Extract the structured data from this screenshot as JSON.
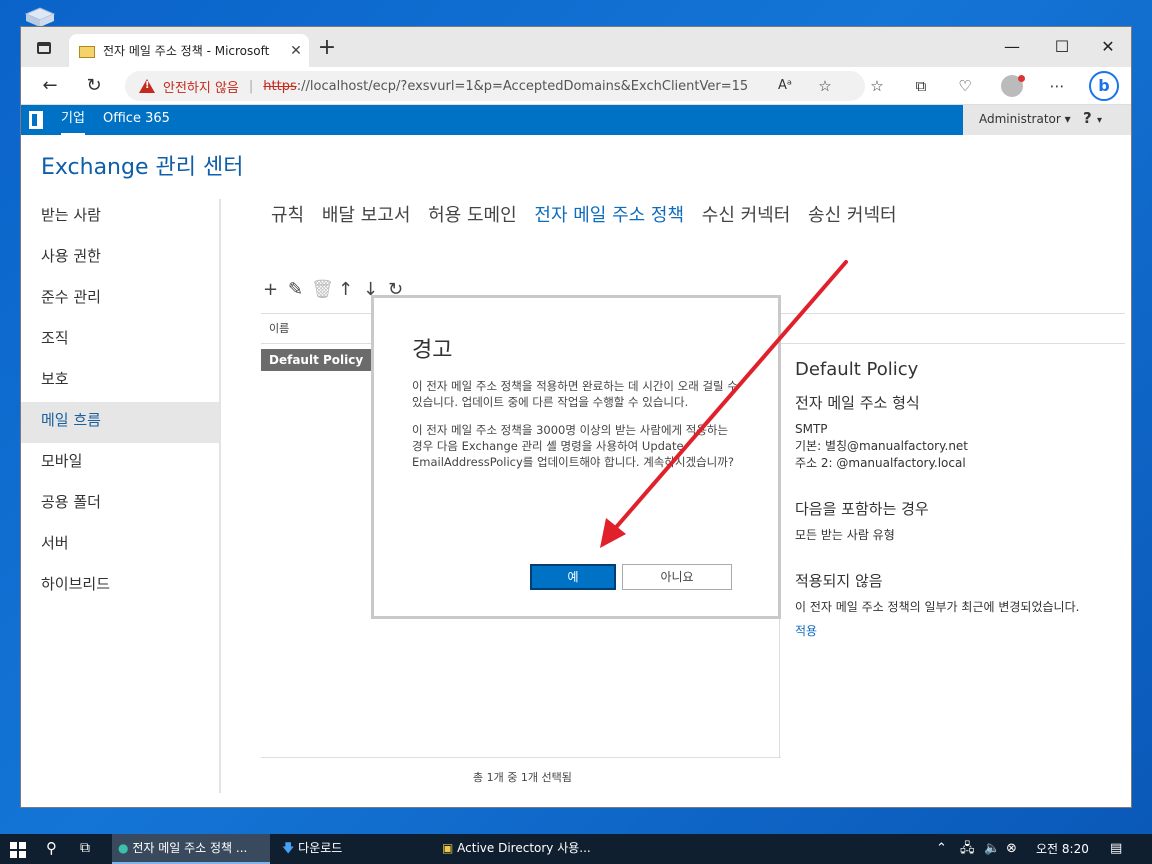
{
  "browser": {
    "tab_title": "전자 메일 주소 정책 - Microsoft",
    "insecure_label": "안전하지 않음",
    "url_proto": "https",
    "url_rest": "://localhost/ecp/?exsvurl=1&p=AcceptedDomains&ExchClientVer=15"
  },
  "header": {
    "corp": "기업",
    "o365": "Office 365",
    "admin": "Administrator",
    "help": "?"
  },
  "app": {
    "title": "Exchange 관리 센터"
  },
  "leftnav": [
    {
      "label": "받는 사람"
    },
    {
      "label": "사용 권한"
    },
    {
      "label": "준수 관리"
    },
    {
      "label": "조직"
    },
    {
      "label": "보호"
    },
    {
      "label": "메일 흐름"
    },
    {
      "label": "모바일"
    },
    {
      "label": "공용 폴더"
    },
    {
      "label": "서버"
    },
    {
      "label": "하이브리드"
    }
  ],
  "tabs": [
    {
      "label": "규칙"
    },
    {
      "label": "배달 보고서"
    },
    {
      "label": "허용 도메인"
    },
    {
      "label": "전자 메일 주소 정책"
    },
    {
      "label": "수신 커넥터"
    },
    {
      "label": "송신 커넥터"
    }
  ],
  "list": {
    "column": "이름",
    "selected_row": "Default Policy",
    "status": "총 1개 중 1개 선택됨"
  },
  "detail": {
    "title": "Default Policy",
    "format_heading": "전자 메일 주소 형식",
    "format_type": "SMTP",
    "primary": "기본: 별칭@manualfactory.net",
    "secondary": "주소 2: @manualfactory.local",
    "include_heading": "다음을 포함하는 경우",
    "include_value": "모든 받는 사람 유형",
    "not_applied_heading": "적용되지 않음",
    "not_applied_text": "이 전자 메일 주소 정책의 일부가 최근에 변경되었습니다.",
    "apply_link": "적용"
  },
  "dialog": {
    "title": "경고",
    "p1": "이 전자 메일 주소 정책을 적용하면 완료하는 데 시간이 오래 걸릴 수 있습니다. 업데이트 중에 다른 작업을 수행할 수 있습니다.",
    "p2": "이 전자 메일 주소 정책을 3000명 이상의 받는 사람에게 적용하는 경우 다음 Exchange 관리 셸 명령을 사용하여 Update-EmailAddressPolicy를 업데이트해야 합니다. 계속하시겠습니까?",
    "yes": "예",
    "no": "아니요"
  },
  "taskbar": {
    "item1": "전자 메일 주소 정책 ...",
    "item2": "다운로드",
    "item3": "Active Directory 사용...",
    "time": "오전 8:20"
  },
  "colors": {
    "accent": "#0072c6",
    "annotation_arrow": "#e0202a"
  }
}
